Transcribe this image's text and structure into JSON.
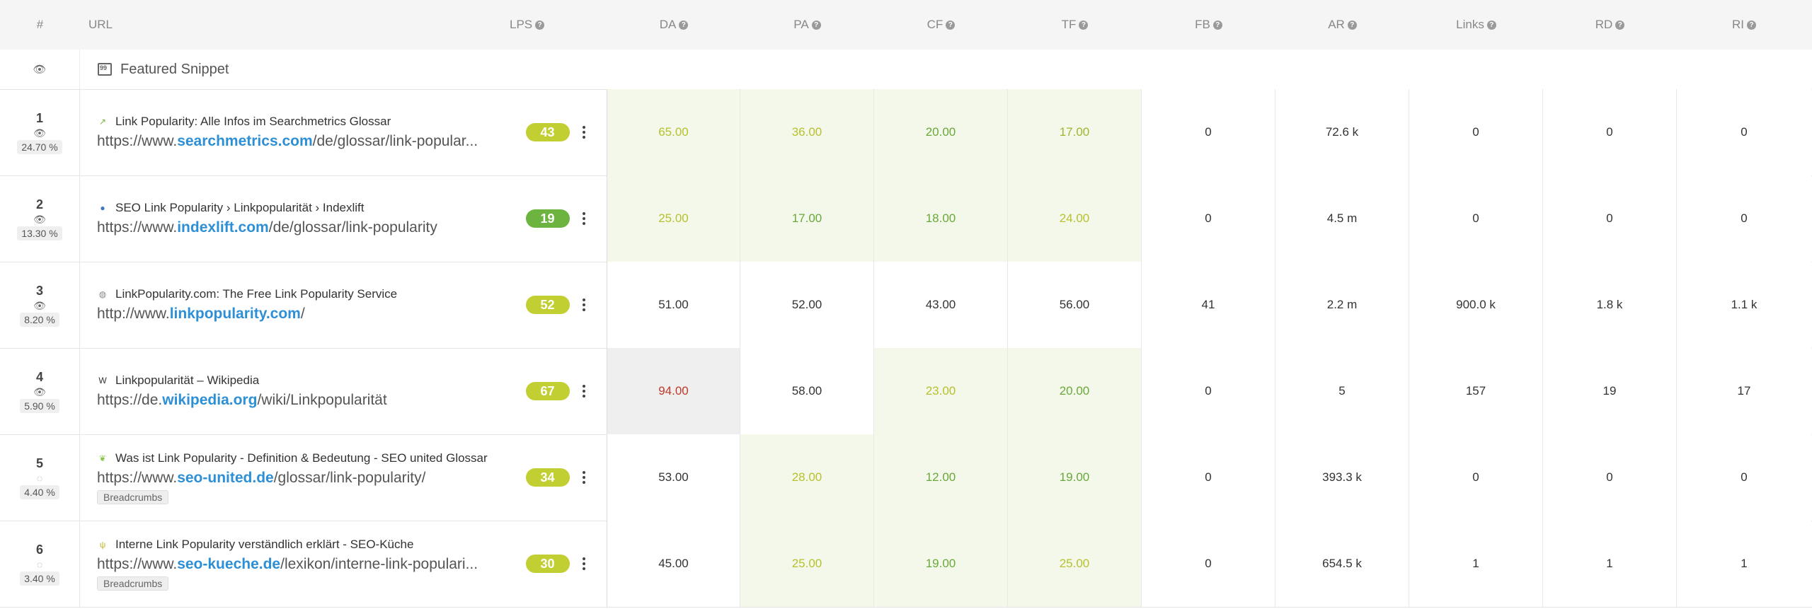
{
  "header": {
    "num": "#",
    "url": "URL",
    "lps": "LPS",
    "metrics": [
      "DA",
      "PA",
      "CF",
      "TF",
      "FB",
      "AR",
      "Links",
      "RD",
      "RI"
    ]
  },
  "featured": {
    "label": "Featured Snippet"
  },
  "rows": [
    {
      "rank": "1",
      "share": "24.70 %",
      "visible": true,
      "title": "Link Popularity: Alle Infos im Searchmetrics Glossar",
      "url_prefix": "https://www.",
      "url_domain": "searchmetrics.com",
      "url_path": "/de/glossar/link-popular...",
      "badge": "",
      "lps": "43",
      "lps_color": "#c2cf32",
      "values": [
        "65.00",
        "36.00",
        "20.00",
        "17.00",
        "0",
        "72.6 k",
        "0",
        "0",
        "0"
      ],
      "colors": [
        "#b7c12d",
        "#b7c12d",
        "#6aa83a",
        "#9cb82f",
        "#333333",
        "#333333",
        "#333333",
        "#333333",
        "#333333"
      ],
      "bgs": [
        "#f3f8ea",
        "#f3f8ea",
        "#f3f8ea",
        "#f3f8ea",
        "#ffffff",
        "#ffffff",
        "#ffffff",
        "#ffffff",
        "#ffffff"
      ],
      "fav_icon": "chart-trend-icon",
      "fav_color": "#7cb342"
    },
    {
      "rank": "2",
      "share": "13.30 %",
      "visible": true,
      "title": "SEO Link Popularity › Linkpopularität › Indexlift",
      "url_prefix": "https://www.",
      "url_domain": "indexlift.com",
      "url_path": "/de/glossar/link-popularity",
      "badge": "",
      "lps": "19",
      "lps_color": "#6cb33f",
      "values": [
        "25.00",
        "17.00",
        "18.00",
        "24.00",
        "0",
        "4.5 m",
        "0",
        "0",
        "0"
      ],
      "colors": [
        "#b7c12d",
        "#6aa83a",
        "#6aa83a",
        "#b7c12d",
        "#333333",
        "#333333",
        "#333333",
        "#333333",
        "#333333"
      ],
      "bgs": [
        "#f3f8ea",
        "#f3f8ea",
        "#f3f8ea",
        "#f3f8ea",
        "#ffffff",
        "#ffffff",
        "#ffffff",
        "#ffffff",
        "#ffffff"
      ],
      "fav_icon": "globe-blue-icon",
      "fav_color": "#3b78c4"
    },
    {
      "rank": "3",
      "share": "8.20 %",
      "visible": true,
      "title": "LinkPopularity.com: The Free Link Popularity Service",
      "url_prefix": "http://www.",
      "url_domain": "linkpopularity.com",
      "url_path": "/",
      "badge": "",
      "lps": "52",
      "lps_color": "#c2cf32",
      "values": [
        "51.00",
        "52.00",
        "43.00",
        "56.00",
        "41",
        "2.2 m",
        "900.0 k",
        "1.8 k",
        "1.1 k"
      ],
      "colors": [
        "#333333",
        "#333333",
        "#333333",
        "#333333",
        "#333333",
        "#333333",
        "#333333",
        "#333333",
        "#333333"
      ],
      "bgs": [
        "#ffffff",
        "#ffffff",
        "#ffffff",
        "#ffffff",
        "#ffffff",
        "#ffffff",
        "#ffffff",
        "#ffffff",
        "#ffffff"
      ],
      "fav_icon": "globe-outline-icon",
      "fav_color": "#888888"
    },
    {
      "rank": "4",
      "share": "5.90 %",
      "visible": true,
      "title": "Linkpopularität – Wikipedia",
      "url_prefix": "https://de.",
      "url_domain": "wikipedia.org",
      "url_path": "/wiki/Linkpopularität",
      "badge": "",
      "lps": "67",
      "lps_color": "#c2cf32",
      "values": [
        "94.00",
        "58.00",
        "23.00",
        "20.00",
        "0",
        "5",
        "157",
        "19",
        "17"
      ],
      "colors": [
        "#c0392b",
        "#333333",
        "#b7c12d",
        "#6aa83a",
        "#333333",
        "#333333",
        "#333333",
        "#333333",
        "#333333"
      ],
      "bgs": [
        "#efefef",
        "#ffffff",
        "#f3f8ea",
        "#f3f8ea",
        "#ffffff",
        "#ffffff",
        "#ffffff",
        "#ffffff",
        "#ffffff"
      ],
      "fav_icon": "wikipedia-w-icon",
      "fav_color": "#333333"
    },
    {
      "rank": "5",
      "share": "4.40 %",
      "visible": false,
      "title": "Was ist Link Popularity - Definition & Bedeutung - SEO united Glossar",
      "url_prefix": "https://www.",
      "url_domain": "seo-united.de",
      "url_path": "/glossar/link-popularity/",
      "badge": "Breadcrumbs",
      "lps": "34",
      "lps_color": "#c2cf32",
      "values": [
        "53.00",
        "28.00",
        "12.00",
        "19.00",
        "0",
        "393.3 k",
        "0",
        "0",
        "0"
      ],
      "colors": [
        "#333333",
        "#b7c12d",
        "#6aa83a",
        "#6aa83a",
        "#333333",
        "#333333",
        "#333333",
        "#333333",
        "#333333"
      ],
      "bgs": [
        "#ffffff",
        "#f3f8ea",
        "#f3f8ea",
        "#f3f8ea",
        "#ffffff",
        "#ffffff",
        "#ffffff",
        "#ffffff",
        "#ffffff"
      ],
      "fav_icon": "leaf-icon",
      "fav_color": "#8bc34a"
    },
    {
      "rank": "6",
      "share": "3.40 %",
      "visible": false,
      "title": "Interne Link Popularity verständlich erklärt - SEO-Küche",
      "url_prefix": "https://www.",
      "url_domain": "seo-kueche.de",
      "url_path": "/lexikon/interne-link-populari...",
      "badge": "Breadcrumbs",
      "lps": "30",
      "lps_color": "#c2cf32",
      "values": [
        "45.00",
        "25.00",
        "19.00",
        "25.00",
        "0",
        "654.5 k",
        "1",
        "1",
        "1"
      ],
      "colors": [
        "#333333",
        "#b7c12d",
        "#6aa83a",
        "#b7c12d",
        "#333333",
        "#333333",
        "#333333",
        "#333333",
        "#333333"
      ],
      "bgs": [
        "#ffffff",
        "#f3f8ea",
        "#f3f8ea",
        "#f3f8ea",
        "#ffffff",
        "#ffffff",
        "#ffffff",
        "#ffffff",
        "#ffffff"
      ],
      "fav_icon": "cutlery-icon",
      "fav_color": "#c6b32f"
    }
  ]
}
